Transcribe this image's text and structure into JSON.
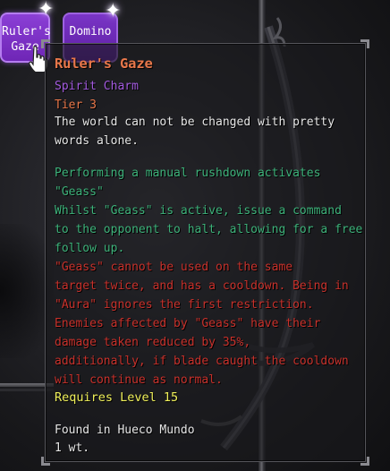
{
  "tabs": [
    {
      "label_line1": "Ruler's",
      "label_line2": "Gaze"
    },
    {
      "label_line1": "Domino"
    }
  ],
  "colors": {
    "tab_active": "#8b3fd6",
    "tab_inactive": "#7a35c6",
    "item_name": "#e8774a",
    "item_type": "#a45be0",
    "effect_green": "#3db27a",
    "effect_red": "#c8312b",
    "requirement": "#f0f05a",
    "body_text": "#e6e6e6"
  },
  "icons": [
    "sparkle-icon",
    "hand-cursor-icon"
  ],
  "tooltip": {
    "name": "Ruler's Gaze",
    "type": "Spirit Charm",
    "tier": "Tier 3",
    "lore": [
      "The world can not be changed with pretty",
      "words alone."
    ],
    "effects_green": [
      "Performing a manual rushdown activates",
      "\"Geass\"",
      "Whilst \"Geass\" is active, issue a command",
      "to the opponent to halt, allowing for a free",
      "follow up."
    ],
    "effects_red": [
      "\"Geass\" cannot be used on the same",
      "target twice, and has a cooldown. Being in",
      "\"Aura\" ignores the first restriction.",
      "Enemies affected by \"Geass\" have their",
      "damage taken reduced by 35%,",
      "additionally, if blade caught the cooldown",
      "will continue as normal."
    ],
    "requirement": "Requires Level 15",
    "found_in": "Found in Hueco Mundo",
    "weight": "1 wt."
  }
}
